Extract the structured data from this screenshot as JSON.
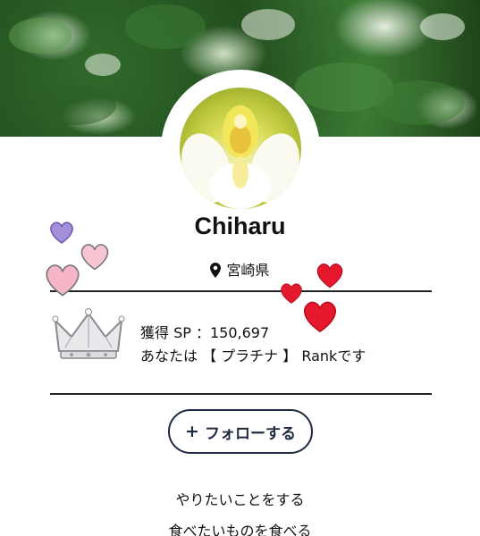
{
  "profile": {
    "name": "Chiharu",
    "location": "宮崎県"
  },
  "rank": {
    "points_line": "獲得 SP ：150,697",
    "rank_line": "あなたは 【 プラチナ 】 Rankです"
  },
  "follow": {
    "plus": "+",
    "label": "フォローする"
  },
  "bio": {
    "line1": "やりたいことをする",
    "line2": "食べたいものを食べる"
  },
  "colors": {
    "button_border": "#1e2a3e",
    "heart_red": "#e6182d",
    "heart_pink": "#f6b8c8",
    "heart_purple": "#9a84d6"
  },
  "icons": [
    "location-pin-icon",
    "crown-icon",
    "heart-icon"
  ]
}
